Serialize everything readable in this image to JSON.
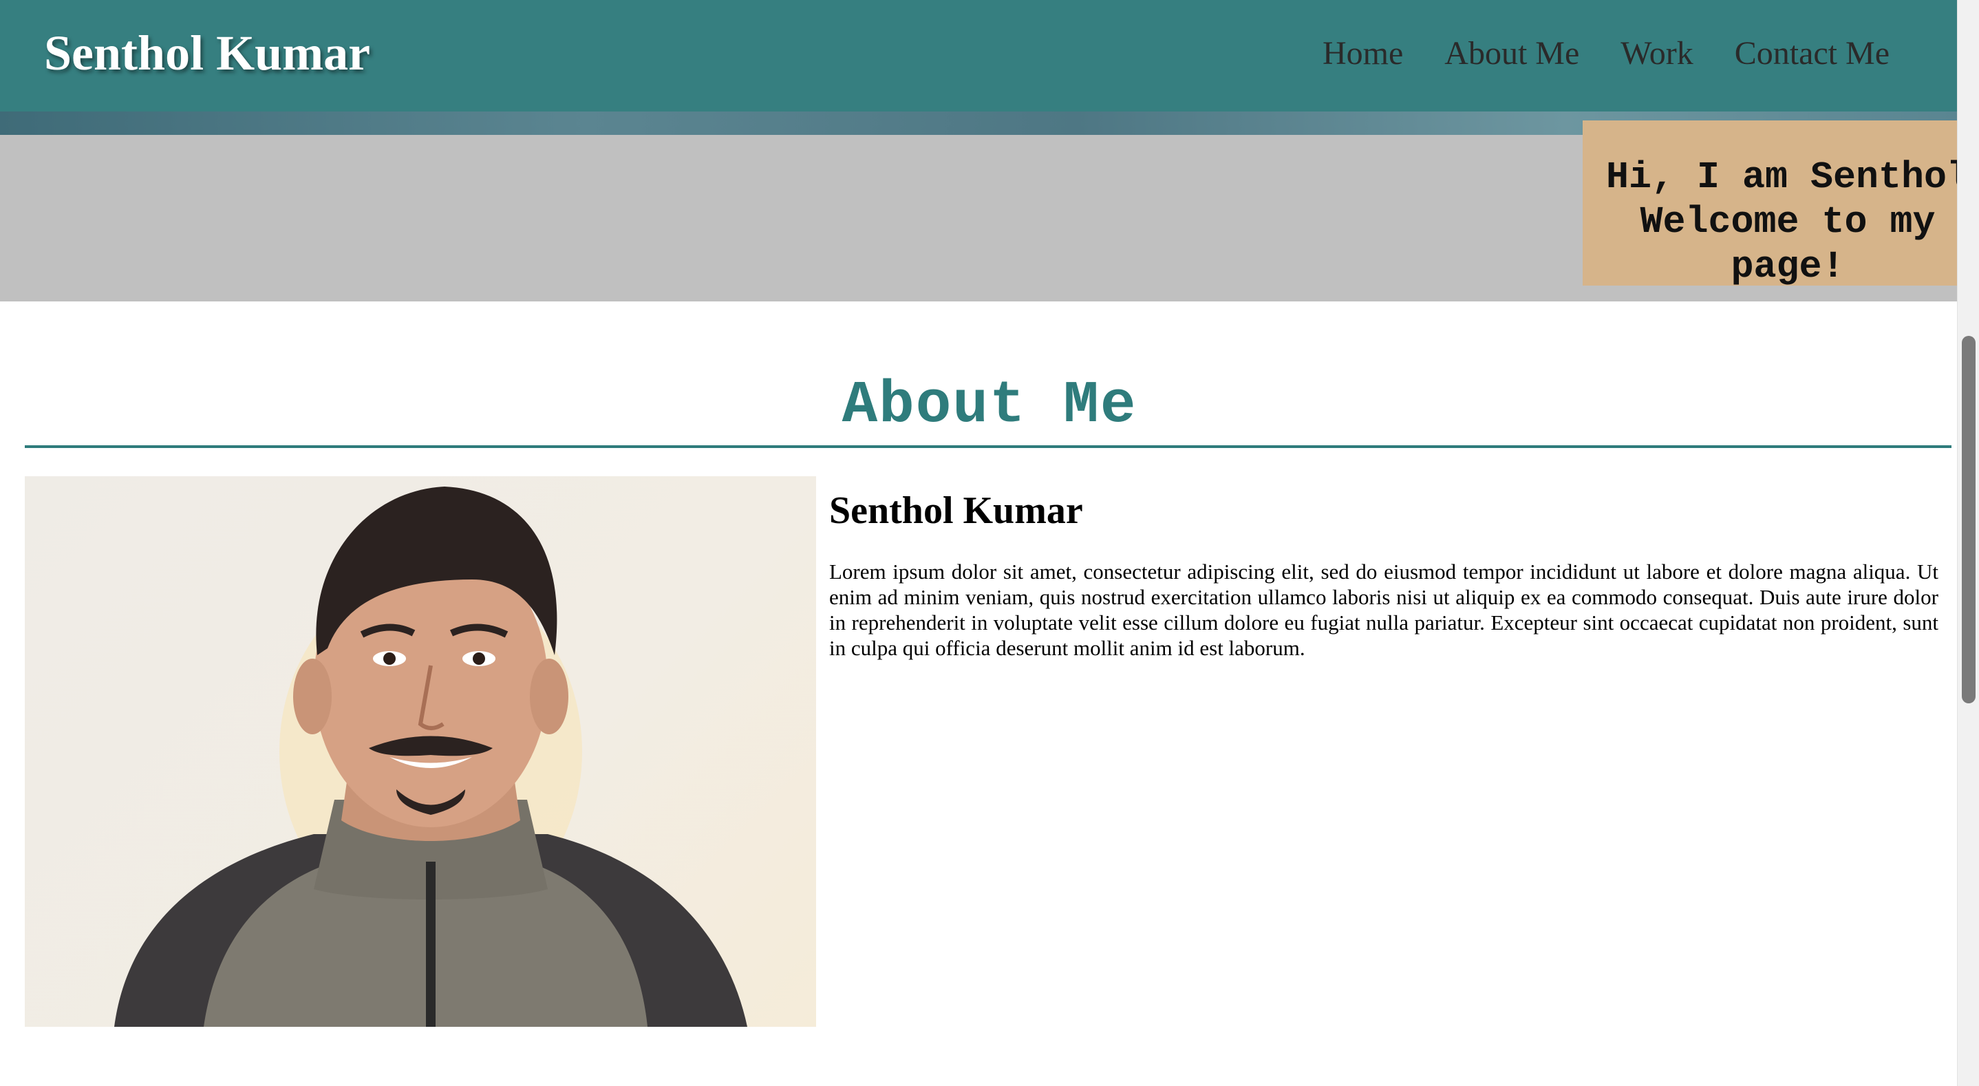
{
  "header": {
    "brand": "Senthol Kumar",
    "nav": [
      "Home",
      "About Me",
      "Work",
      "Contact Me"
    ]
  },
  "hero": {
    "greeting": "Hi, I am Senthol\nWelcome to my\npage!"
  },
  "about": {
    "title": "About Me",
    "name": "Senthol Kumar",
    "bio": "Lorem ipsum dolor sit amet, consectetur adipiscing elit, sed do eiusmod tempor incididunt ut labore et dolore magna aliqua. Ut enim ad minim veniam, quis nostrud exercitation ullamco laboris nisi ut aliquip ex ea commodo consequat. Duis aute irure dolor in reprehenderit in voluptate velit esse cillum dolore eu fugiat nulla pariatur. Excepteur sint occaecat cupidatat non proident, sunt in culpa qui officia deserunt mollit anim id est laborum."
  },
  "colors": {
    "navbar": "#367f80",
    "accent": "#2f7c7c",
    "greeting_box": "#d6b48a",
    "hero_gray": "#c0c0c0"
  }
}
